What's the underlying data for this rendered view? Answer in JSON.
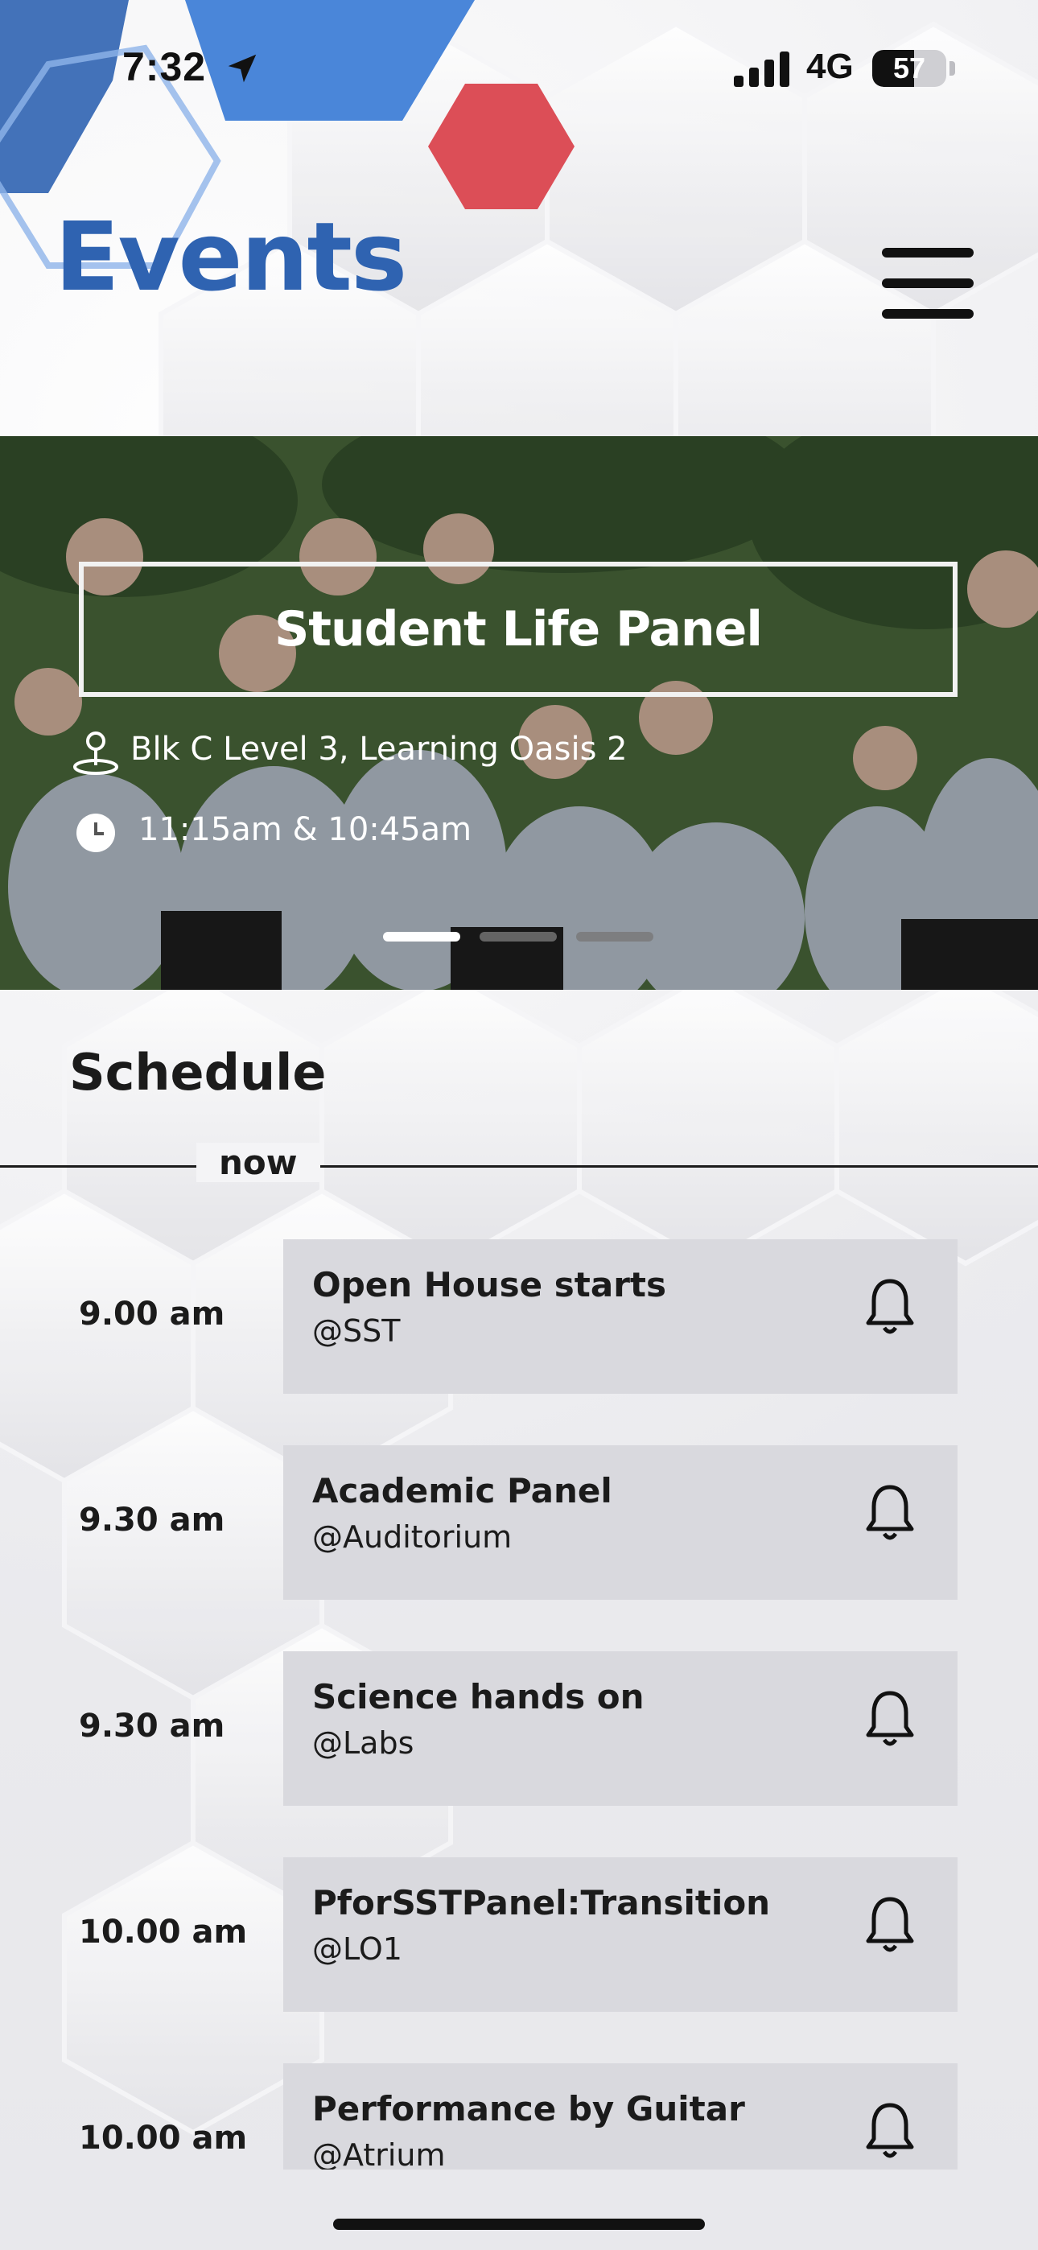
{
  "status_bar": {
    "time": "7:32",
    "network": "4G",
    "battery": "57",
    "battery_level": 0.57
  },
  "header": {
    "title": "Events",
    "menu_icon": "hamburger-menu-icon"
  },
  "hero": {
    "title": "Student Life Panel",
    "location": "Blk C Level 3, Learning Oasis 2",
    "time": "11:15am & 10:45am",
    "location_icon": "map-pin-icon",
    "time_icon": "clock-icon",
    "slide_count": 3,
    "active_slide": 1
  },
  "schedule": {
    "title": "Schedule",
    "now_label": "now",
    "items": [
      {
        "time": "9.00 am",
        "name": "Open House starts",
        "venue": "@SST"
      },
      {
        "time": "9.30 am",
        "name": "Academic Panel",
        "venue": "@Auditorium"
      },
      {
        "time": "9.30 am",
        "name": "Science hands on",
        "venue": "@Labs"
      },
      {
        "time": "10.00 am",
        "name": "PforSSTPanel:Transition",
        "venue": "@LO1"
      },
      {
        "time": "10.00 am",
        "name": "Performance by Guitar",
        "venue": "@Atrium"
      }
    ]
  },
  "colors": {
    "title_blue": "#2f63b1",
    "card_gray": "#d9d9de",
    "hex_red": "#dc4e57",
    "hex_blue": "#4a86d9"
  }
}
